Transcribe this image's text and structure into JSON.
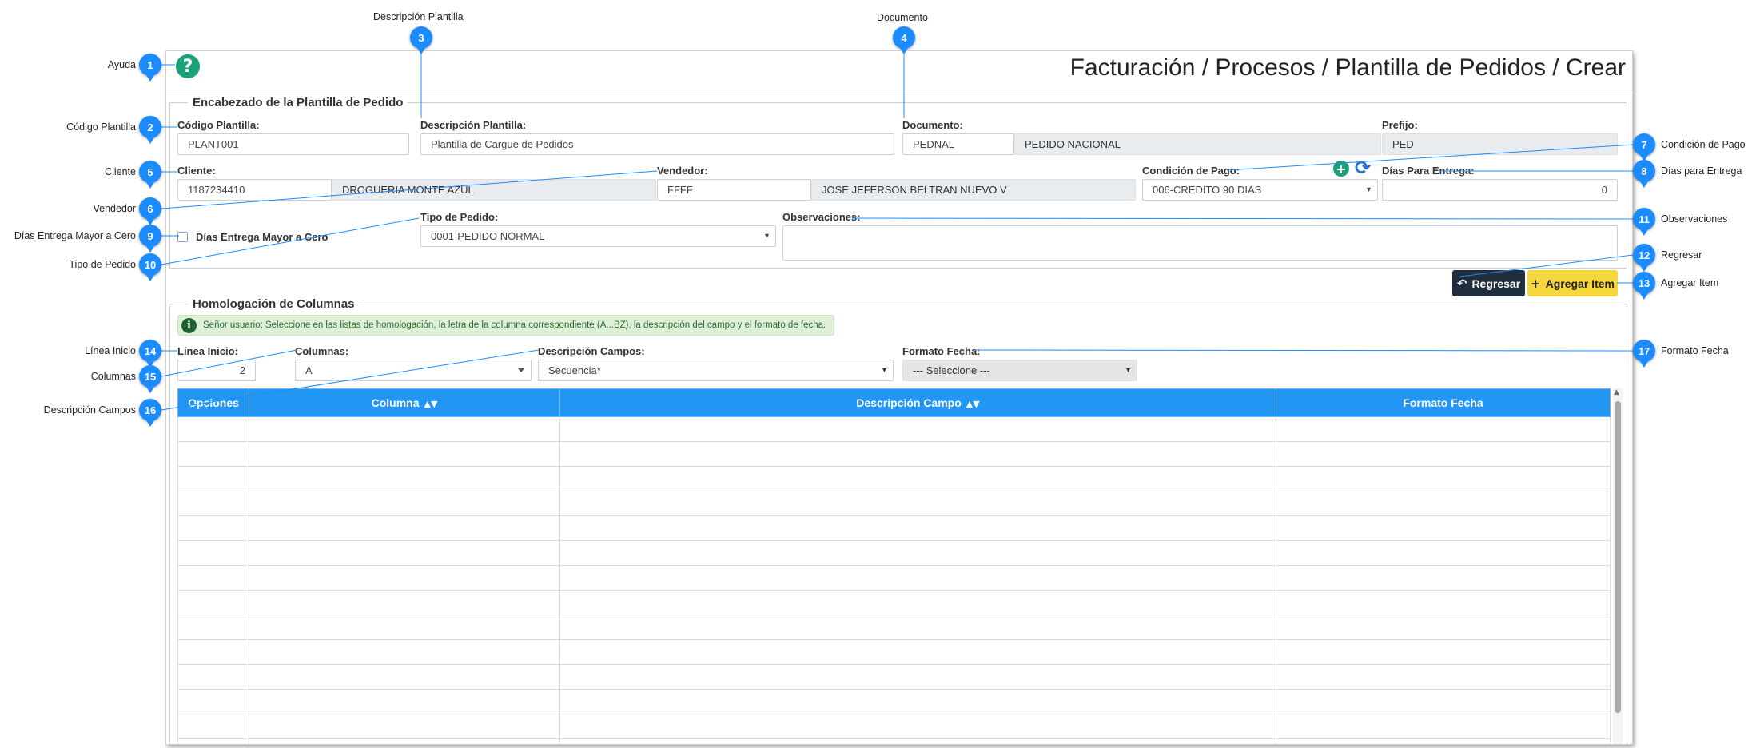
{
  "page": {
    "title": "Facturación / Procesos / Plantilla de Pedidos / Crear",
    "help_icon": "question-circle-icon"
  },
  "annotations": [
    {
      "n": "1",
      "label": "Ayuda"
    },
    {
      "n": "2",
      "label": "Código Plantilla"
    },
    {
      "n": "3",
      "label": "Descripción Plantilla"
    },
    {
      "n": "4",
      "label": "Documento"
    },
    {
      "n": "5",
      "label": "Cliente"
    },
    {
      "n": "6",
      "label": "Vendedor"
    },
    {
      "n": "7",
      "label": "Condición de Pago"
    },
    {
      "n": "8",
      "label": "Días para Entrega"
    },
    {
      "n": "9",
      "label": "Días Entrega Mayor a Cero"
    },
    {
      "n": "10",
      "label": "Tipo de Pedido"
    },
    {
      "n": "11",
      "label": "Observaciones"
    },
    {
      "n": "12",
      "label": "Regresar"
    },
    {
      "n": "13",
      "label": "Agregar Item"
    },
    {
      "n": "14",
      "label": "Línea Inicio"
    },
    {
      "n": "15",
      "label": "Columnas"
    },
    {
      "n": "16",
      "label": "Descripción Campos"
    },
    {
      "n": "17",
      "label": "Formato Fecha"
    }
  ],
  "header_section": {
    "legend": "Encabezado de la Plantilla de Pedido",
    "codigo": {
      "label": "Código Plantilla:",
      "value": "PLANT001"
    },
    "descripcion": {
      "label": "Descripción Plantilla:",
      "value": "Plantilla de Cargue de Pedidos"
    },
    "documento": {
      "label": "Documento:",
      "code": "PEDNAL",
      "name": "PEDIDO NACIONAL"
    },
    "prefijo": {
      "label": "Prefijo:",
      "value": "PED"
    },
    "cliente": {
      "label": "Cliente:",
      "code": "1187234410",
      "name": "DROGUERIA MONTE AZUL"
    },
    "vendedor": {
      "label": "Vendedor:",
      "code": "FFFF",
      "name": "JOSE JEFERSON BELTRAN NUEVO V"
    },
    "condicion": {
      "label": "Condición de Pago:",
      "value": "006-CREDITO 90 DIAS"
    },
    "dias_entrega": {
      "label": "Días Para Entrega:",
      "value": "0"
    },
    "dias_mayor": {
      "label": "Días Entrega Mayor a Cero",
      "checked": false
    },
    "tipo_pedido": {
      "label": "Tipo de Pedido:",
      "value": "0001-PEDIDO NORMAL"
    },
    "observaciones": {
      "label": "Observaciones:",
      "value": ""
    }
  },
  "buttons": {
    "regresar": "Regresar",
    "agregar": "Agregar Item"
  },
  "homologacion": {
    "legend": "Homologación de Columnas",
    "info": "Señor usuario; Seleccione en las listas de homologación, la letra de la columna correspondiente (A...BZ), la descripción del campo y el formato de fecha.",
    "linea_inicio": {
      "label": "Línea Inicio:",
      "value": "2"
    },
    "columnas": {
      "label": "Columnas:",
      "value": "A"
    },
    "descripcion_campos": {
      "label": "Descripción Campos:",
      "value": "Secuencia*"
    },
    "formato_fecha": {
      "label": "Formato Fecha:",
      "value": "--- Seleccione ---"
    }
  },
  "table": {
    "headers": [
      "Opciones",
      "Columna",
      "Descripción Campo",
      "Formato Fecha"
    ],
    "rows": 14
  },
  "colors": {
    "badge": "#1a8cff",
    "table_header": "#2196f3",
    "primary_yellow": "#f6d73b",
    "dark_button": "#1f2d3d",
    "help_green": "#1aa17a"
  }
}
